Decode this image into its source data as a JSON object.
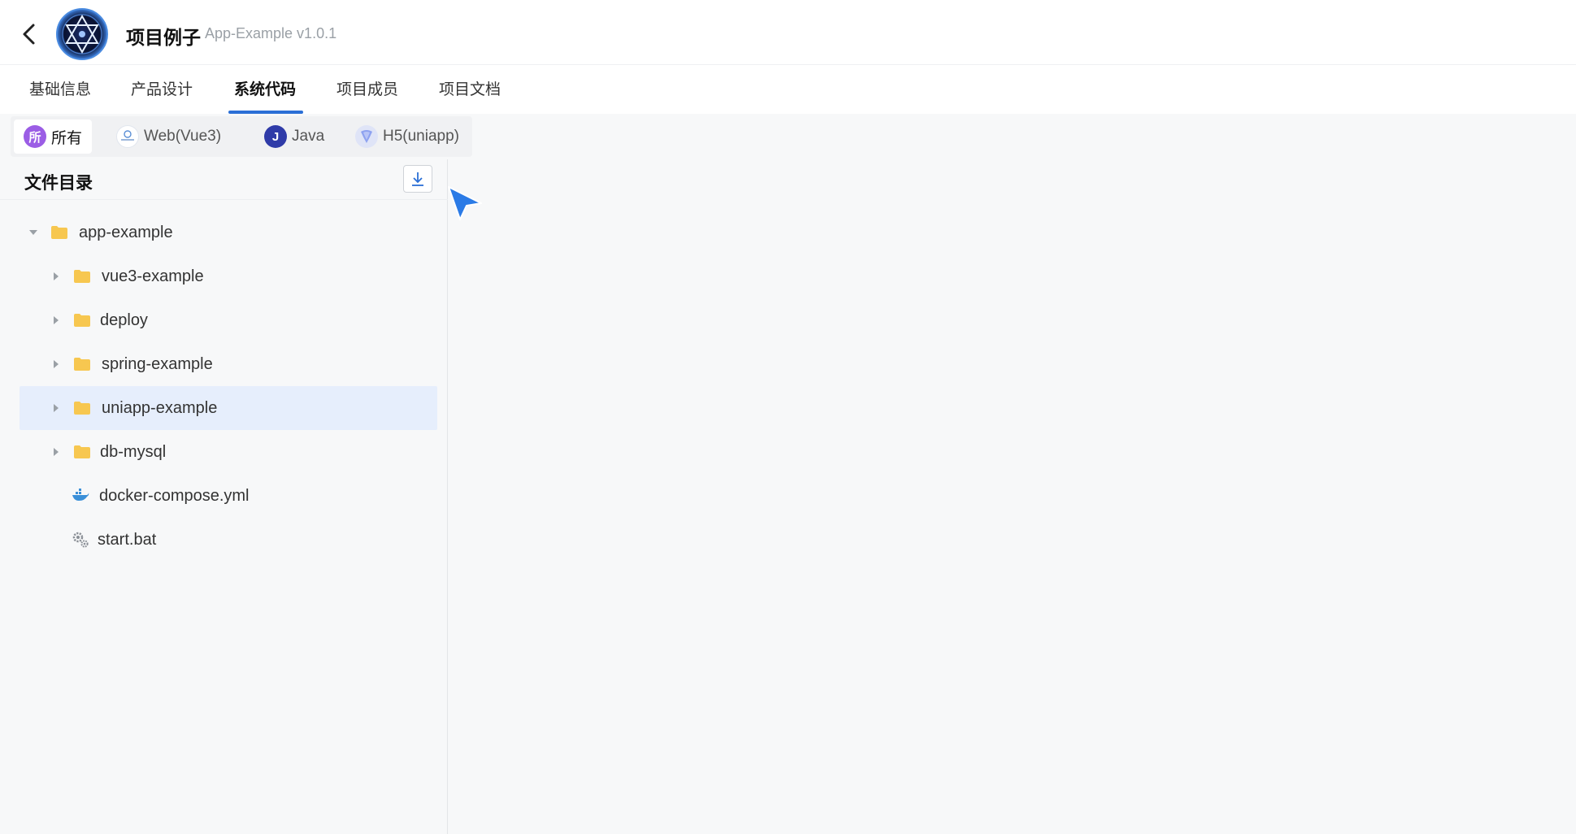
{
  "header": {
    "title": "项目例子",
    "subtitle": "App-Example v1.0.1"
  },
  "tabs": [
    {
      "label": "基础信息"
    },
    {
      "label": "产品设计"
    },
    {
      "label": "系统代码"
    },
    {
      "label": "项目成员"
    },
    {
      "label": "项目文档"
    }
  ],
  "active_tab": "系统代码",
  "chips": [
    {
      "label": "所有",
      "icon_text": "所",
      "icon": "all-icon",
      "color": "#9b5de5"
    },
    {
      "label": "Web(Vue3)",
      "icon": "web-vue-icon"
    },
    {
      "label": "Java",
      "icon_text": "J",
      "icon": "java-icon",
      "color": "#2f3ba8"
    },
    {
      "label": "H5(uniapp)",
      "icon": "uniapp-icon"
    }
  ],
  "panel": {
    "title": "文件目录"
  },
  "tree": [
    {
      "label": "app-example",
      "type": "folder",
      "expanded": true
    },
    {
      "label": "vue3-example",
      "type": "folder"
    },
    {
      "label": "deploy",
      "type": "folder"
    },
    {
      "label": "spring-example",
      "type": "folder"
    },
    {
      "label": "uniapp-example",
      "type": "folder",
      "selected": true
    },
    {
      "label": "db-mysql",
      "type": "folder"
    },
    {
      "label": "docker-compose.yml",
      "type": "file",
      "icon": "docker-icon"
    },
    {
      "label": "start.bat",
      "type": "file",
      "icon": "gear-icon"
    }
  ],
  "colors": {
    "accent": "#2b6fd6",
    "folder": "#f7c750",
    "selected_row": "#e6eefc"
  }
}
